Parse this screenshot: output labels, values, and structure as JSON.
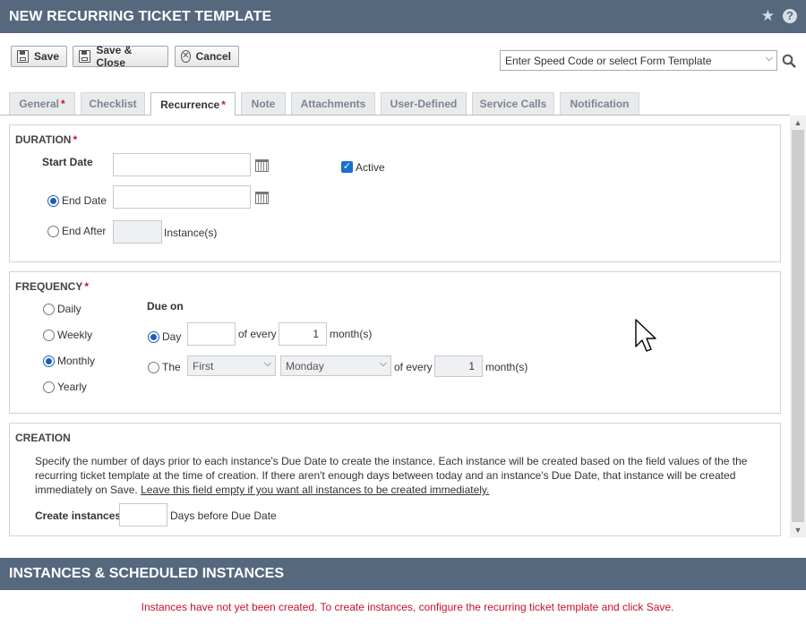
{
  "window": {
    "title": "NEW RECURRING TICKET TEMPLATE"
  },
  "toolbar": {
    "save": "Save",
    "save_close": "Save & Close",
    "cancel": "Cancel"
  },
  "speed_code": {
    "value": "Enter Speed Code or select Form Template"
  },
  "tabs": [
    {
      "label": "General",
      "required": "*"
    },
    {
      "label": "Checklist",
      "required": ""
    },
    {
      "label": "Recurrence",
      "required": "*",
      "active": true
    },
    {
      "label": "Note",
      "required": ""
    },
    {
      "label": "Attachments",
      "required": ""
    },
    {
      "label": "User-Defined",
      "required": ""
    },
    {
      "label": "Service Calls",
      "required": ""
    },
    {
      "label": "Notification",
      "required": ""
    }
  ],
  "duration": {
    "title": "DURATION",
    "required": "*",
    "start_date_label": "Start Date",
    "start_date_value": "",
    "active_label": "Active",
    "active_checked": true,
    "end_date_label": "End Date",
    "end_date_value": "",
    "end_after_label": "End After",
    "end_after_value": "",
    "instances_label": "Instance(s)"
  },
  "frequency": {
    "title": "FREQUENCY",
    "required": "*",
    "options": [
      "Daily",
      "Weekly",
      "Monthly",
      "Yearly"
    ],
    "selected": "Monthly",
    "due_on_label": "Due on",
    "day_label": "Day",
    "day_value": "",
    "of_every_label": "of every",
    "every_months_value": "1",
    "months_label": "month(s)",
    "the_label": "The",
    "ordinal_value": "First",
    "weekday_value": "Monday",
    "the_every_months_value": "1"
  },
  "creation": {
    "title": "CREATION",
    "description": "Specify the number of days prior to each instance's Due Date to create the instance. Each instance will be created based on the field values of the the recurring ticket template at the time of creation. If there aren't enough days between today and an instance's Due Date, that instance will be created immediately on Save. ",
    "description_link": "Leave this field empty if you want all instances to be created immediately.",
    "create_label": "Create instances",
    "create_value": "",
    "days_label": "Days before Due Date"
  },
  "instances": {
    "title": "INSTANCES & SCHEDULED INSTANCES",
    "message": "Instances have not yet been created. To create instances, configure the recurring ticket template and click Save."
  },
  "colors": {
    "header": "#56687e",
    "accent": "#1a5fb4",
    "required": "#c8102e"
  }
}
